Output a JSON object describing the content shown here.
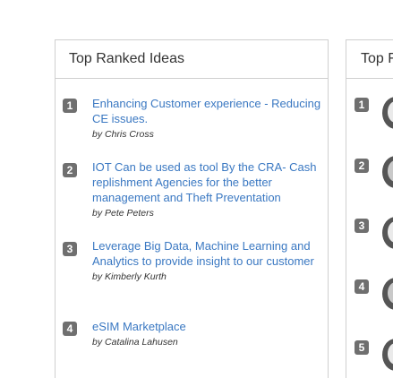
{
  "left_panel": {
    "title": "Top Ranked Ideas",
    "ideas": [
      {
        "rank": "1",
        "title": "Enhancing Customer experience - Reducing CE issues.",
        "by": "by",
        "author": "Chris Cross"
      },
      {
        "rank": "2",
        "title": "IOT Can be used as tool By the CRA- Cash replishment Agencies for the better management and Theft Preventation",
        "by": "by",
        "author": "Pete Peters"
      },
      {
        "rank": "3",
        "title": "Leverage Big Data, Machine Learning and Analytics to provide insight to our customer",
        "by": "by",
        "author": "Kimberly Kurth"
      },
      {
        "rank": "4",
        "title": "eSIM Marketplace",
        "by": "by",
        "author": "Catalina Lahusen"
      }
    ]
  },
  "right_panel": {
    "title": "Top F",
    "ranks": [
      "1",
      "2",
      "3",
      "4",
      "5"
    ]
  },
  "colors": {
    "link": "#3a78c2",
    "badge": "#6f6f6f",
    "border": "#cfcfcf"
  }
}
